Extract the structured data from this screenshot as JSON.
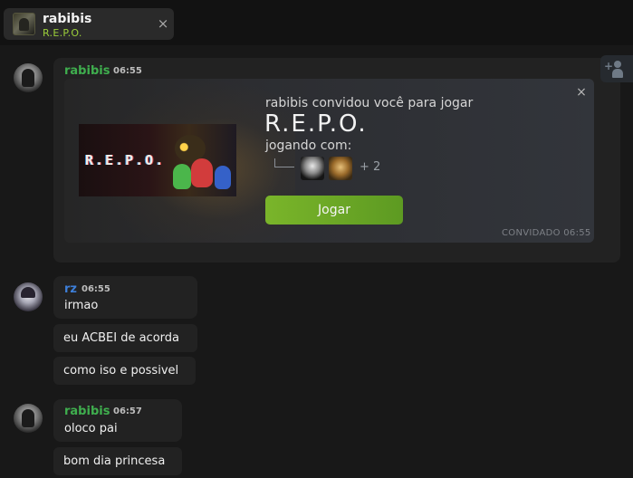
{
  "tab": {
    "name": "rabibis",
    "game": "R.E.P.O.",
    "close": "×"
  },
  "messages": [
    {
      "sender": "rabibis",
      "time": "06:55",
      "invite": {
        "title": "rabibis convidou você para jogar",
        "game": "R.E.P.O.",
        "banner_text": "R.E.P.O.",
        "playing_label": "jogando com:",
        "extra_players": "+ 2",
        "join_label": "Jogar",
        "status": "CONVIDADO 06:55",
        "close": "×"
      }
    },
    {
      "sender": "rz",
      "time": "06:55",
      "lines": [
        "irmao",
        "eu ACBEI de acorda",
        "como iso e possivel"
      ]
    },
    {
      "sender": "rabibis",
      "time": "06:57",
      "lines": [
        "oloco pai",
        "bom dia princesa"
      ]
    }
  ],
  "colors": {
    "background": "#171717",
    "sender_rabibis": "#3fae4e",
    "sender_rz": "#3d7fd9",
    "join_button": "#6aa826",
    "game_accent": "#9ccf3a"
  },
  "icons": {
    "add_friend": "person-plus-icon"
  }
}
